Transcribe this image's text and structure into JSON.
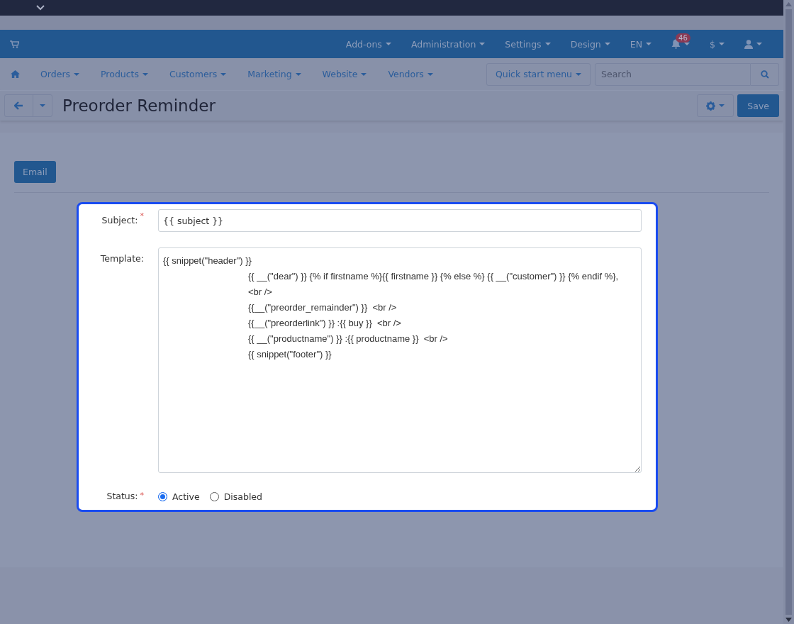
{
  "main_menu": {
    "items": [
      {
        "kind": "text",
        "label": "Add-ons"
      },
      {
        "kind": "text",
        "label": "Administration"
      },
      {
        "kind": "text",
        "label": "Settings"
      },
      {
        "kind": "text",
        "label": "Design"
      },
      {
        "kind": "text",
        "label": "EN"
      },
      {
        "kind": "bell",
        "badge": "46"
      },
      {
        "kind": "text",
        "label": "$"
      },
      {
        "kind": "user"
      }
    ]
  },
  "nav": {
    "items": [
      {
        "label": "Orders"
      },
      {
        "label": "Products"
      },
      {
        "label": "Customers"
      },
      {
        "label": "Marketing"
      },
      {
        "label": "Website"
      },
      {
        "label": "Vendors"
      }
    ],
    "quick_start": "Quick start menu",
    "search": {
      "placeholder": "Search"
    }
  },
  "page": {
    "title": "Preorder Reminder",
    "save": "Save"
  },
  "tabs": [
    {
      "label": "Email",
      "selected": true
    }
  ],
  "form": {
    "fields": [
      {
        "kind": "input",
        "label": "Subject:",
        "required_mark": "*",
        "value": "{{ subject }}"
      },
      {
        "kind": "textarea",
        "label": "Template:",
        "value": "{{ snippet(\"header\") }}\n\t\t\t\t\t\t\t\t{{ __(\"dear\") }} {% if firstname %}{{ firstname }} {% else %} {{ __(\"customer\") }} {% endif %},\n\t\t\t\t\t\t\t\t<br />\n\t\t\t\t\t\t\t\t{{__(\"preorder_remainder\") }}  <br />\n\t\t\t\t\t\t\t\t{{__(\"preorderlink\") }} :{{ buy }}  <br />\n\t\t\t\t\t\t\t\t{{ __(\"productname\") }} :{{ productname }}  <br />\n\t\t\t\t\t\t\t\t{{ snippet(\"footer\") }}"
      },
      {
        "kind": "radio",
        "label": "Status:",
        "required_mark": "*",
        "options": [
          {
            "label": "Active",
            "selected": true
          },
          {
            "label": "Disabled",
            "selected": false
          }
        ]
      }
    ]
  }
}
